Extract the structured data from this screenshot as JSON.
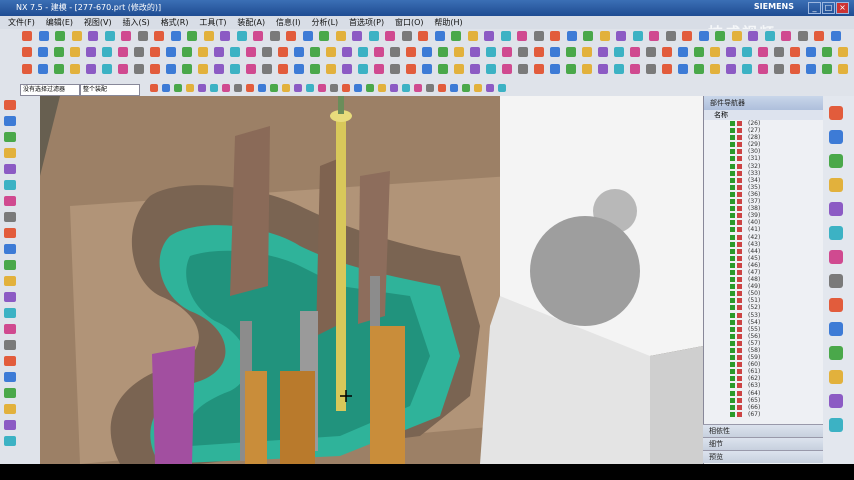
{
  "window": {
    "title": "NX 7.5 - 建模 - [277-670.prt (修改的)]",
    "brand": "SIEMENS",
    "controls": [
      "_",
      "□",
      "×"
    ]
  },
  "menu": {
    "items": [
      "文件(F)",
      "编辑(E)",
      "视图(V)",
      "插入(S)",
      "格式(R)",
      "工具(T)",
      "装配(A)",
      "信息(I)",
      "分析(L)",
      "首选项(P)",
      "窗口(O)",
      "帮助(H)"
    ]
  },
  "watermark": "技成视频",
  "selection_bar": {
    "filter": "没有选择过滤器",
    "scope": "整个装配"
  },
  "navigator": {
    "title": "部件导航器",
    "column": "名称",
    "rows": [
      "(26)",
      "(27)",
      "(28)",
      "(29)",
      "(30)",
      "(31)",
      "(32)",
      "(33)",
      "(34)",
      "(35)",
      "(36)",
      "(37)",
      "(38)",
      "(39)",
      "(40)",
      "(41)",
      "(42)",
      "(43)",
      "(44)",
      "(45)",
      "(46)",
      "(47)",
      "(48)",
      "(49)",
      "(50)",
      "(51)",
      "(52)",
      "(53)",
      "(54)",
      "(55)",
      "(56)",
      "(57)",
      "(58)",
      "(59)",
      "(60)",
      "(61)",
      "(62)",
      "(63)",
      "(64)",
      "(65)",
      "(66)",
      "(67)"
    ],
    "panels": [
      "相依性",
      "细节",
      "预览"
    ]
  },
  "colors": {
    "mold": "#9c8066",
    "insert": "#2fb39a",
    "block": "#f4f4f4",
    "pin": "#8c8c8c",
    "slider": "#a24fa0",
    "copper": "#c98d3a"
  }
}
